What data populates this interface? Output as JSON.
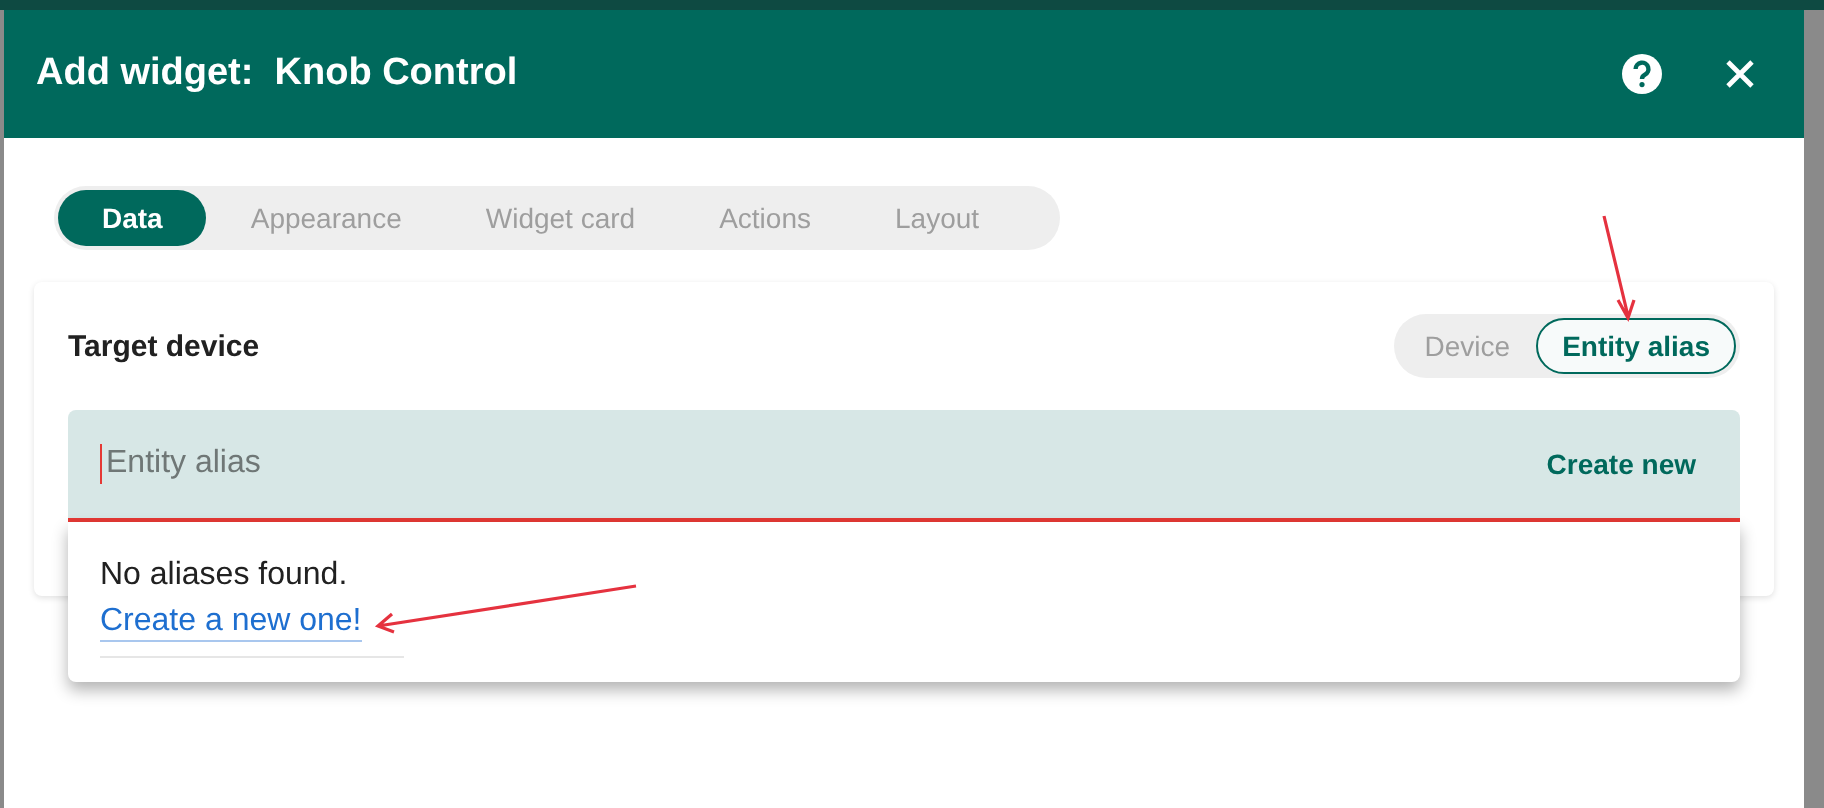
{
  "dialog": {
    "title": "Add widget:  Knob Control"
  },
  "tabs": [
    {
      "label": "Data",
      "selected": true
    },
    {
      "label": "Appearance",
      "selected": false
    },
    {
      "label": "Widget card",
      "selected": false
    },
    {
      "label": "Actions",
      "selected": false
    },
    {
      "label": "Layout",
      "selected": false
    }
  ],
  "target": {
    "label": "Target device",
    "options": [
      {
        "label": "Device",
        "selected": false
      },
      {
        "label": "Entity alias",
        "selected": true
      }
    ]
  },
  "alias_field": {
    "placeholder": "Entity alias",
    "action": "Create new"
  },
  "dropdown": {
    "message": "No aliases found.",
    "link": "Create a new one!"
  }
}
